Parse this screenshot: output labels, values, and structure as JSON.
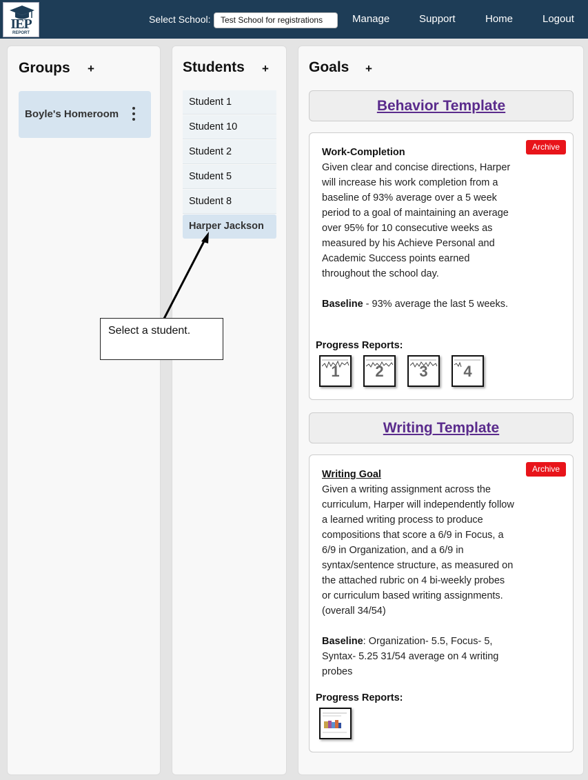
{
  "header": {
    "logo_text": "IEP",
    "logo_subtext": "REPORT",
    "select_school_label": "Select School:",
    "school_value": "Test School for registrations",
    "nav": [
      "Manage",
      "Support",
      "Home",
      "Logout"
    ]
  },
  "groups": {
    "title": "Groups",
    "add_label": "+",
    "items": [
      {
        "name": "Boyle's Homeroom"
      }
    ]
  },
  "students": {
    "title": "Students",
    "add_label": "+",
    "items": [
      {
        "name": "Student 1"
      },
      {
        "name": "Student 10"
      },
      {
        "name": "Student 2"
      },
      {
        "name": "Student 5"
      },
      {
        "name": "Student 8"
      },
      {
        "name": "Harper Jackson",
        "selected": true
      }
    ]
  },
  "goals": {
    "title": "Goals",
    "add_label": "+",
    "templates": [
      {
        "name": "Behavior Template",
        "goal_title": "Work-Completion",
        "goal_text": "Given clear and concise directions, Harper will increase his work completion from a baseline of 93% average over a 5 week period to a goal of maintaining an average over 95% for 10 consecutive weeks as measured by his Achieve Personal and Academic Success points earned throughout the school day.",
        "baseline_label": "Baseline",
        "baseline_text": " - 93% average the last 5 weeks.",
        "archive_label": "Archive",
        "progress_label": "Progress Reports:",
        "reports": [
          "1",
          "2",
          "3",
          "4"
        ]
      },
      {
        "name": "Writing Template",
        "goal_title": "Writing Goal",
        "goal_text": "Given a writing assignment across the curriculum, Harper will independently follow a learned writing process to produce compositions that score a 6/9 in Focus, a 6/9 in Organization, and a 6/9 in syntax/sentence structure, as measured on the attached rubric on 4 bi-weekly probes or curriculum based writing assignments. (overall 34/54)",
        "baseline_label": "Baseline",
        "baseline_text": ": Organization- 5.5, Focus- 5, Syntax- 5.25 31/54 average on 4 writing probes",
        "archive_label": "Archive",
        "progress_label": "Progress Reports:",
        "reports": [
          ""
        ]
      }
    ]
  },
  "annotation": {
    "text": "Select a student."
  },
  "colors": {
    "header_bg": "#1e3d57",
    "archive": "#e8141a",
    "template_link": "#5a2b8c",
    "selected": "#d6e4f0"
  }
}
